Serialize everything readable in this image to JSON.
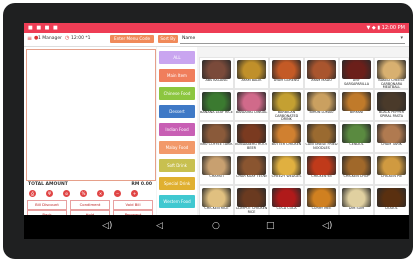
{
  "statusbar": {
    "left": "■ ■ ■ ■",
    "right": "▼ ◆ ▮ 12:00 PM"
  },
  "topbar": {
    "user": "1 Manager",
    "time": "12:00 *1",
    "enter_memo": "Enter Menu Code",
    "sort_by": "Sort By",
    "sort_value": "Name"
  },
  "order": {
    "total_label": "TOTAL AMOUNT",
    "total_value": "RM 0.00"
  },
  "actions": {
    "row1": [
      "Bill Discount",
      "Condiment",
      "Void Bill"
    ],
    "row2": [
      "Back",
      "Hold",
      "Payment"
    ]
  },
  "categories": [
    {
      "label": "ALL",
      "color": "#c9a5f0"
    },
    {
      "label": "Main Item",
      "color": "#f07e5c"
    },
    {
      "label": "Chinese Food",
      "color": "#8cc63f"
    },
    {
      "label": "Dessert",
      "color": "#3f79c6"
    },
    {
      "label": "Indian Food",
      "color": "#c85fb4"
    },
    {
      "label": "Malay Food",
      "color": "#f2996a"
    },
    {
      "label": "Soft Drink",
      "color": "#c8c050"
    },
    {
      "label": "Special Drink",
      "color": "#e0b030"
    },
    {
      "label": "Western Food",
      "color": "#40c8d0"
    }
  ],
  "menu_items": [
    {
      "label": "ABS KACANG",
      "color": "#7a4a3a"
    },
    {
      "label": "AYAM BALIK",
      "color": "#c0902a"
    },
    {
      "label": "AYAM GORENG",
      "color": "#c45a26"
    },
    {
      "label": "AYAM MADU",
      "color": "#a9552e"
    },
    {
      "label": "AYIF SARSAPARILLA",
      "color": "#6b1f1a"
    },
    {
      "label": "BAKED CHEESE CARBONARA MEATBALL",
      "color": "#d8b070"
    },
    {
      "label": "BANANA LEAF RICE",
      "color": "#3b7a30"
    },
    {
      "label": "BANDUNG DINGAL",
      "color": "#d06a8a"
    },
    {
      "label": "BARBICAN CARBONATED DRINK",
      "color": "#c4a032"
    },
    {
      "label": "BIHUN LUMAU",
      "color": "#caa060"
    },
    {
      "label": "BIRYANI",
      "color": "#c07a2a"
    },
    {
      "label": "BLACK PEPPER SPIRAL PASTA",
      "color": "#4a3a2a"
    },
    {
      "label": "BRU COFFEE TARIK",
      "color": "#8a5a3a"
    },
    {
      "label": "BUNDABERG ROOT BEER",
      "color": "#7a3a20"
    },
    {
      "label": "BUTTER CHICKEN",
      "color": "#d08030"
    },
    {
      "label": "CANTONESE FRIED NOODLES",
      "color": "#9a6a30"
    },
    {
      "label": "CENDOL",
      "color": "#5a8a40"
    },
    {
      "label": "CHAM TARIK",
      "color": "#b07a50"
    },
    {
      "label": "CHAPATI",
      "color": "#c8a070"
    },
    {
      "label": "CHAR KUAY TEOW",
      "color": "#8a5530"
    },
    {
      "label": "CHEEZY WEDGES",
      "color": "#e0b040"
    },
    {
      "label": "CHICKEN 65",
      "color": "#c03a1a"
    },
    {
      "label": "CHICKEN CHOP",
      "color": "#a0682a"
    },
    {
      "label": "CHICKEN PIE",
      "color": "#d09a40"
    },
    {
      "label": "CHICKEN RICE",
      "color": "#e0c080"
    },
    {
      "label": "CLAYPOT CHICKEN RICE",
      "color": "#6a3a20"
    },
    {
      "label": "COCA COLA",
      "color": "#b01a1a"
    },
    {
      "label": "CURRY MEE",
      "color": "#d08020"
    },
    {
      "label": "DIM SUM",
      "color": "#e0d0a0"
    },
    {
      "label": "DODOL",
      "color": "#5a3010"
    }
  ],
  "navbar": {
    "left_icon": "◁)",
    "back": "◁",
    "home": "○",
    "recent": "□",
    "right_icon": "◁)"
  }
}
